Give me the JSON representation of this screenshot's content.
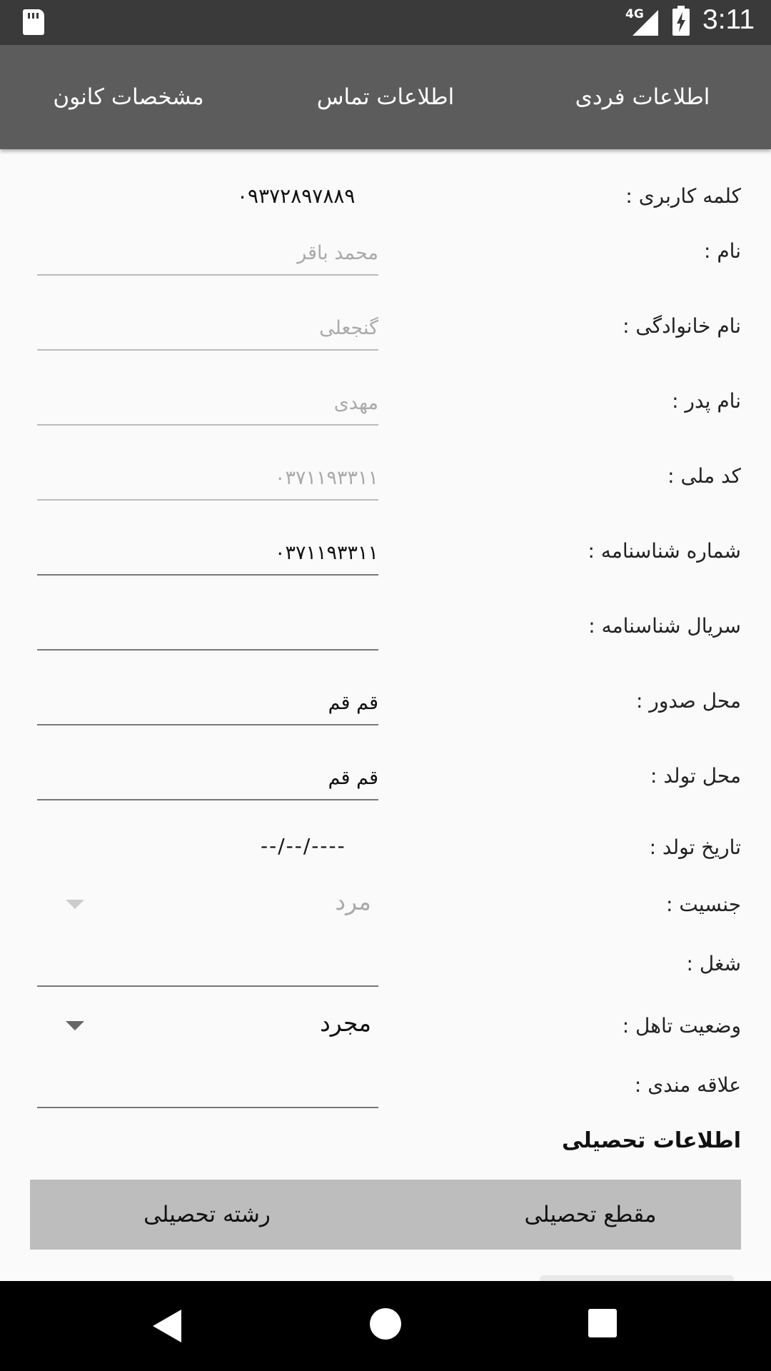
{
  "status_bar": {
    "network": "4G",
    "time": "3:11"
  },
  "tabs": [
    "اطلاعات فردی",
    "اطلاعات تماس",
    "مشخصات کانون"
  ],
  "form": {
    "username_label": "کلمه کاربری :",
    "username_value": "۰۹۳۷۲۸۹۷۸۸۹",
    "first_name_label": "نام :",
    "first_name_placeholder": "محمد باقر",
    "last_name_label": "نام خانوادگی :",
    "last_name_placeholder": "گنجعلی",
    "father_name_label": "نام پدر :",
    "father_name_placeholder": "مهدی",
    "national_code_label": "کد ملی :",
    "national_code_placeholder": "۰۳۷۱۱۹۳۳۱۱",
    "id_number_label": "شماره شناسنامه :",
    "id_number_value": "۰۳۷۱۱۹۳۳۱۱",
    "id_serial_label": "سریال شناسنامه :",
    "id_serial_value": "",
    "issue_place_label": "محل صدور :",
    "issue_place_value": "قم قم",
    "birth_place_label": "محل تولد :",
    "birth_place_value": "قم قم",
    "birth_date_label": "تاریخ تولد :",
    "birth_date_value": "--/--/----",
    "gender_label": "جنسیت :",
    "gender_value": "مرد",
    "job_label": "شغل :",
    "job_value": "",
    "marital_label": "وضعیت تاهل :",
    "marital_value": "مجرد",
    "interests_label": "علاقه مندی :",
    "interests_value": ""
  },
  "education": {
    "title": "اطلاعات تحصیلی",
    "degree_button": "مقطع تحصیلی",
    "field_button": "رشته تحصیلی"
  },
  "colors": {
    "tab_bar": "#5c5c5c",
    "status_bar": "#3a3a3a",
    "edu_bar": "#bdbdbd"
  }
}
